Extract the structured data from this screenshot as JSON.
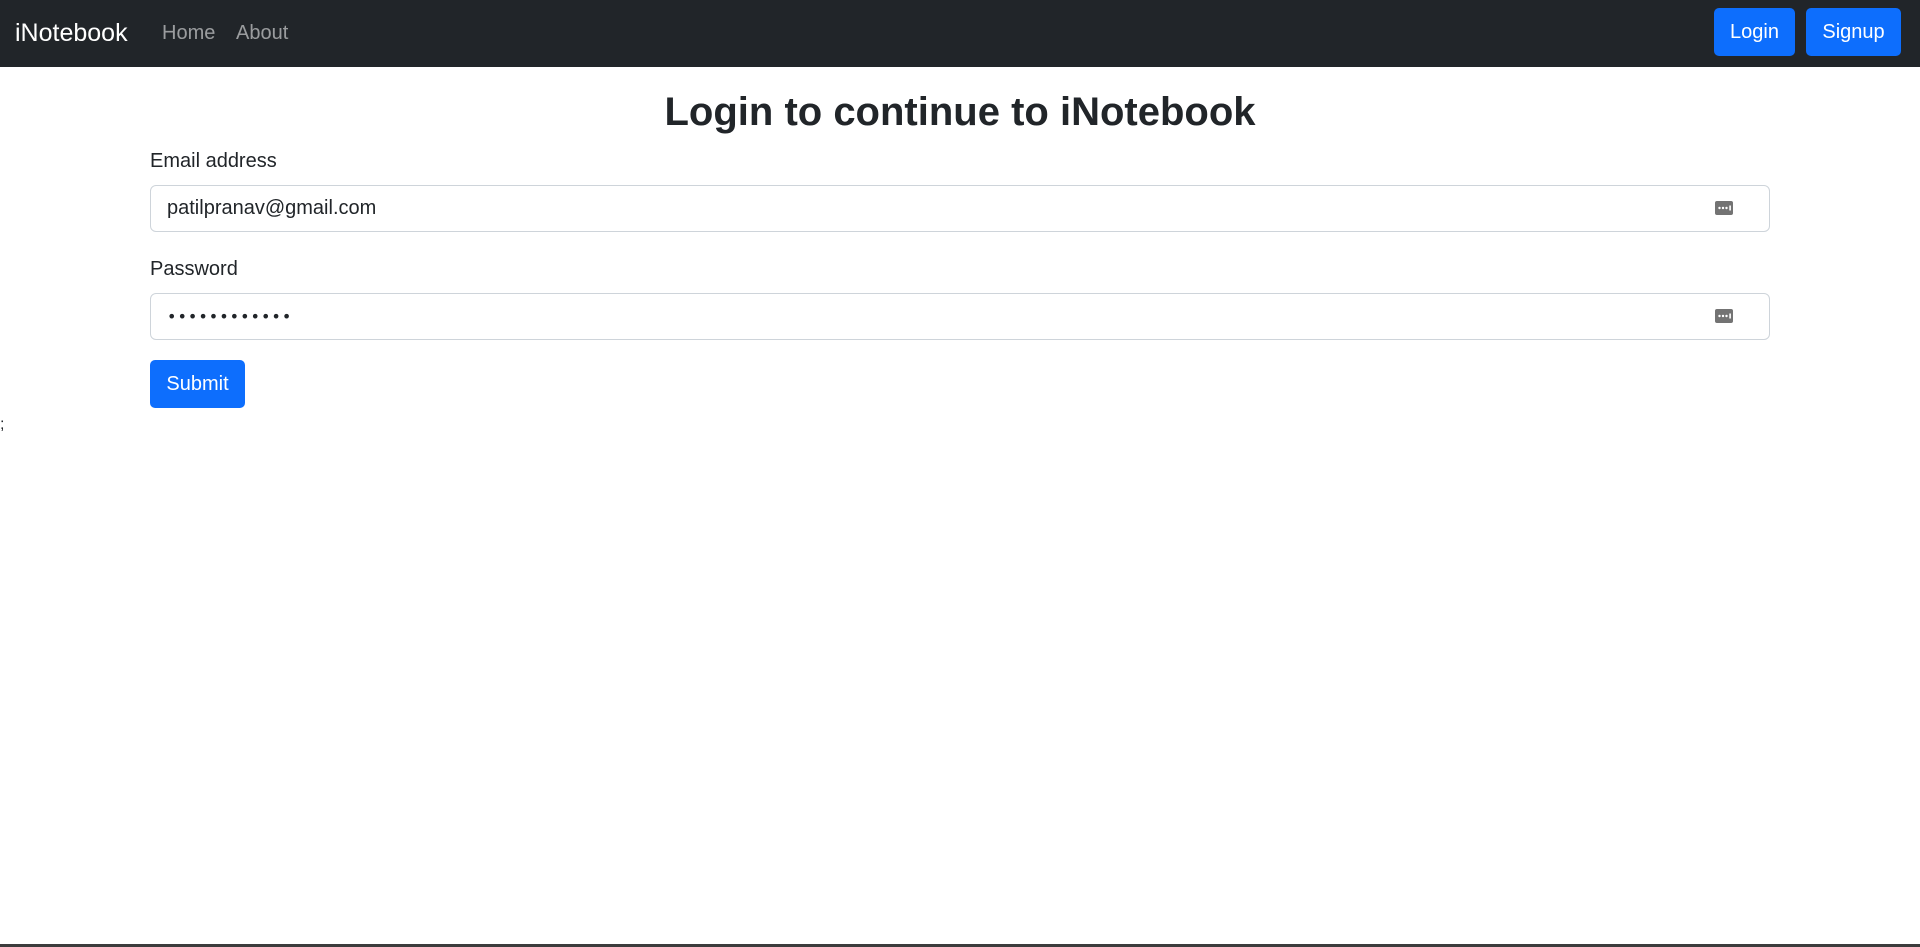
{
  "navbar": {
    "brand": "iNotebook",
    "links": [
      {
        "label": "Home"
      },
      {
        "label": "About"
      }
    ],
    "login_label": "Login",
    "signup_label": "Signup"
  },
  "main": {
    "title": "Login to continue to iNotebook",
    "email": {
      "label": "Email address",
      "value": "patilpranav@gmail.com"
    },
    "password": {
      "label": "Password",
      "value": "••••••••••••"
    },
    "submit_label": "Submit",
    "stray_text": ";"
  },
  "colors": {
    "navbar_bg": "#212529",
    "primary": "#0d6efd",
    "text": "#212529"
  },
  "icons": {
    "field_icon": "password-manager-key-icon"
  }
}
